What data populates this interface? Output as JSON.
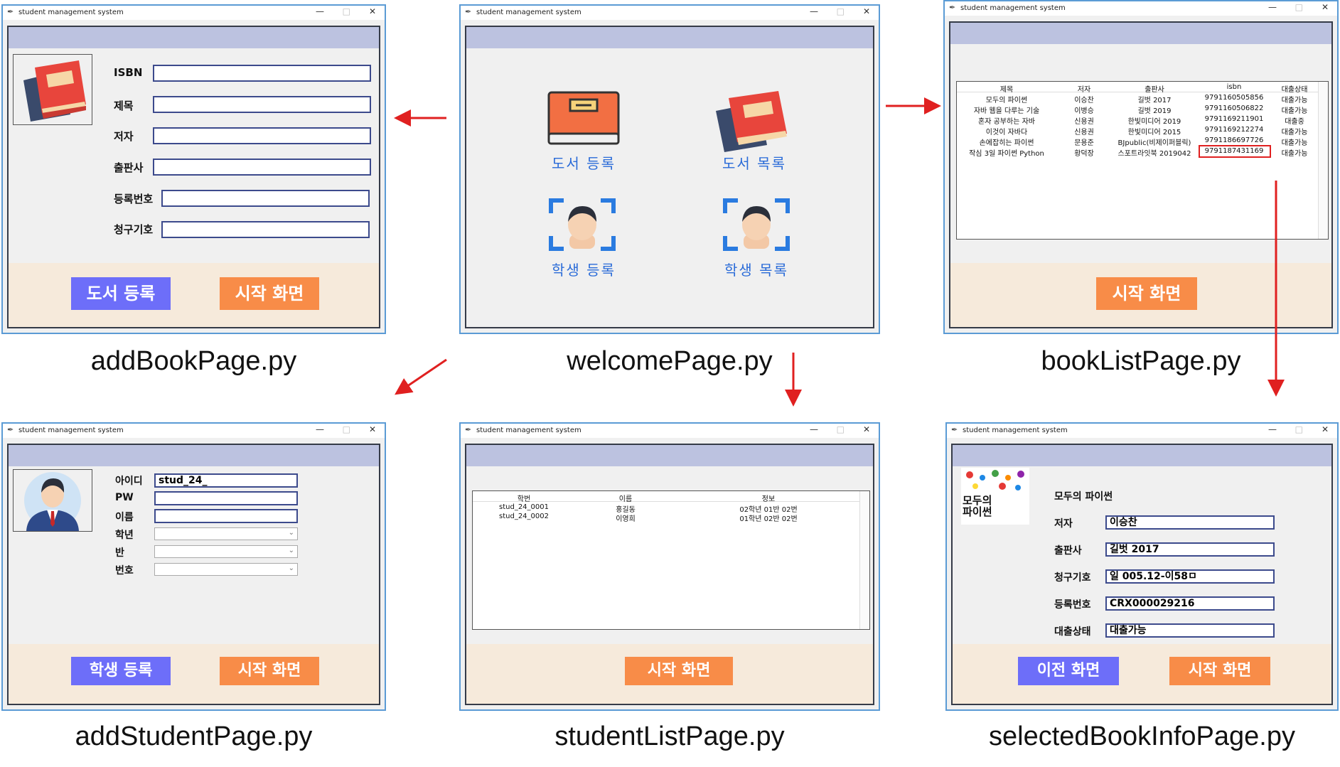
{
  "window_title": "student management system",
  "window_controls": {
    "minimize": "—",
    "maximize": "□",
    "close": "✕"
  },
  "captions": {
    "add_book": "addBookPage.py",
    "welcome": "welcomePage.py",
    "book_list": "bookListPage.py",
    "add_student": "addStudentPage.py",
    "student_list": "studentListPage.py",
    "selected_book": "selectedBookInfoPage.py"
  },
  "add_book": {
    "labels": [
      "ISBN",
      "제목",
      "저자",
      "출판사",
      "등록번호",
      "청구기호"
    ],
    "register_button": "도서 등록",
    "home_button": "시작 화면"
  },
  "welcome": {
    "book_register": "도서 등록",
    "book_list": "도서 목록",
    "student_register": "학생 등록",
    "student_list": "학생 목록"
  },
  "book_list": {
    "columns": [
      "제목",
      "저자",
      "출판사",
      "isbn",
      "대출상태"
    ],
    "rows": [
      [
        "모두의 파이썬",
        "이승찬",
        "길벗 2017",
        "9791160505856",
        "대출가능"
      ],
      [
        "자바 웹을 다루는 기술",
        "이병승",
        "길벗 2019",
        "9791160506822",
        "대출가능"
      ],
      [
        "혼자 공부하는 자바",
        "신용권",
        "한빛미디어 2019",
        "9791169211901",
        "대출중"
      ],
      [
        "이것이 자바다",
        "신용권",
        "한빛미디어 2015",
        "9791169212274",
        "대출가능"
      ],
      [
        "손에잡히는 파이썬",
        "문용준",
        "BJpublic(비제이퍼블릭)",
        "9791186697726",
        "대출가능"
      ],
      [
        "작심 3일 파이썬 Python",
        "황덕장",
        "스포트라잇북 2019042",
        "9791187431169",
        "대출가능"
      ]
    ],
    "home_button": "시작 화면"
  },
  "add_student": {
    "labels": [
      "아이디",
      "PW",
      "이름",
      "학년",
      "반",
      "번호"
    ],
    "id_value": "stud_24_",
    "register_button": "학생 등록",
    "home_button": "시작 화면"
  },
  "student_list": {
    "columns": [
      "학번",
      "이름",
      "정보"
    ],
    "rows": [
      [
        "stud_24_0001",
        "홍길동",
        "02학년 01반 02번"
      ],
      [
        "stud_24_0002",
        "이영희",
        "01학년 02반 02번"
      ]
    ],
    "home_button": "시작 화면"
  },
  "selected_book": {
    "title": "모두의 파이썬",
    "cover_text": "모두의 파이썬",
    "labels": [
      "저자",
      "출판사",
      "청구기호",
      "등록번호",
      "대출상태"
    ],
    "values": [
      "이승찬",
      "길벗 2017",
      "일 005.12-이58ㅁ",
      "CRX000029216",
      "대출가능"
    ],
    "prev_button": "이전 화면",
    "home_button": "시작 화면"
  },
  "colors": {
    "window_border": "#5b9bd5",
    "header_band": "#bcc2e0",
    "footer_band": "#f6eadb",
    "button_blue": "#6d6ef9",
    "button_orange": "#f88c48",
    "arrow": "#e02020",
    "menu_label": "#2a6bd8"
  },
  "icons": [
    "feather-icon",
    "book-icon",
    "books-stack-icon",
    "face-scan-icon",
    "student-avatar-icon",
    "book-cover-image"
  ]
}
